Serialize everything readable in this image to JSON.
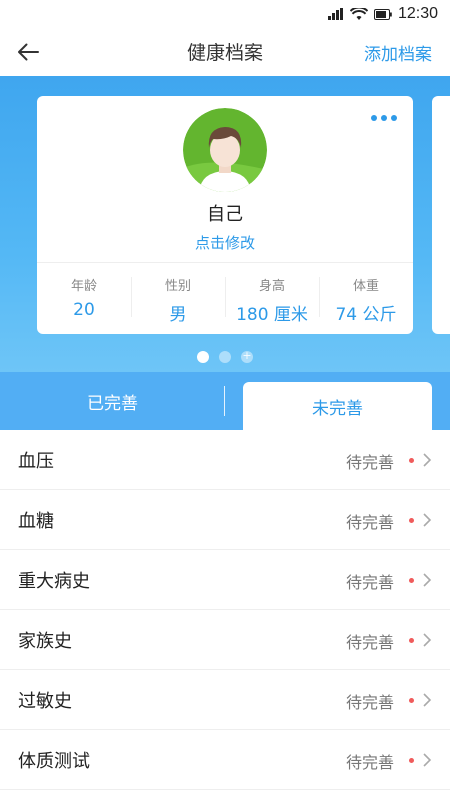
{
  "status_bar": {
    "time": "12:30"
  },
  "nav": {
    "back_icon": "arrow-left-icon",
    "title": "健康档案",
    "action": "添加档案"
  },
  "profile": {
    "name": "自己",
    "edit_label": "点击修改",
    "stats": [
      {
        "label": "年龄",
        "value": "20"
      },
      {
        "label": "性别",
        "value": "男"
      },
      {
        "label": "身高",
        "value": "180 厘米"
      },
      {
        "label": "体重",
        "value": "74 公斤"
      }
    ]
  },
  "tabs": {
    "done": "已完善",
    "todo": "未完善",
    "active": "todo"
  },
  "records": [
    {
      "label": "血压",
      "status": "待完善"
    },
    {
      "label": "血糖",
      "status": "待完善"
    },
    {
      "label": "重大病史",
      "status": "待完善"
    },
    {
      "label": "家族史",
      "status": "待完善"
    },
    {
      "label": "过敏史",
      "status": "待完善"
    },
    {
      "label": "体质测试",
      "status": "待完善"
    }
  ],
  "colors": {
    "accent": "#2d9ae8",
    "header_gradient_top": "#3fa6ef",
    "tab_bar": "#52aef4",
    "pending_dot": "#f05b5b",
    "avatar_bg": "#63b52f"
  }
}
